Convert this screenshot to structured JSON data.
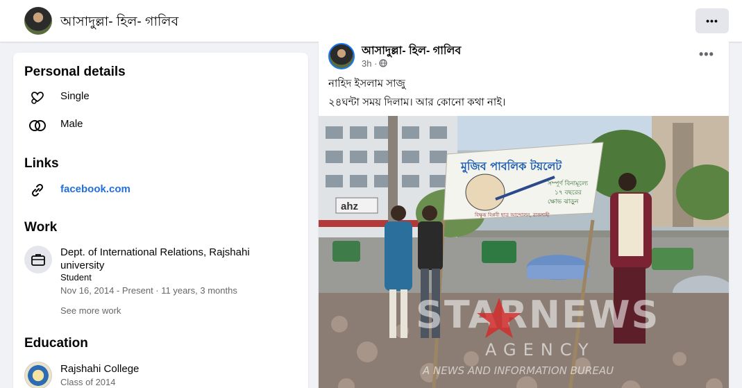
{
  "header": {
    "profile_name": "আসাদুল্লা- হিল- গালিব",
    "more_label": "•••"
  },
  "intro": {
    "personal_title": "Personal details",
    "relationship": "Single",
    "gender": "Male",
    "links_title": "Links",
    "link": "facebook.com",
    "work_title": "Work",
    "work_place": "Dept. of International Relations, Rajshahi university",
    "work_role": "Student",
    "work_dates": "Nov 16, 2014 - Present · 11 years, 3 months",
    "see_more_work": "See more work",
    "education_title": "Education",
    "school": "Rajshahi College",
    "school_class": "Class of 2014"
  },
  "post": {
    "author": "আসাদুল্লা- হিল- গালিব",
    "time": "3h ·",
    "more_label": "•••",
    "line1": "নাহিদ ইসলাম সাজু",
    "line2": "২৪ঘন্টা সময় দিলাম। আর কোনো কথা নাই।",
    "photo": {
      "banner_title": "মুজিব পাবলিক টয়লেট",
      "banner_line1": "সম্পূর্ণ বিনামূল্যে",
      "banner_line2": "১৭ বছরের",
      "banner_line3": "ক্ষোভ ঝাড়ুন",
      "banner_footer": "বিক্ষুব্ধ বিপ্লবী ছাত্র আন্দোলন, রাজশাহী",
      "shop_sign": "ahz",
      "watermark_main": "STARNEWS",
      "watermark_agency": "AGENCY",
      "watermark_tagline": "A NEWS AND INFORMATION BUREAU"
    }
  },
  "colors": {
    "link_blue": "#216fdb",
    "secondary_text": "#65676b",
    "page_bg": "#f0f2f5"
  }
}
